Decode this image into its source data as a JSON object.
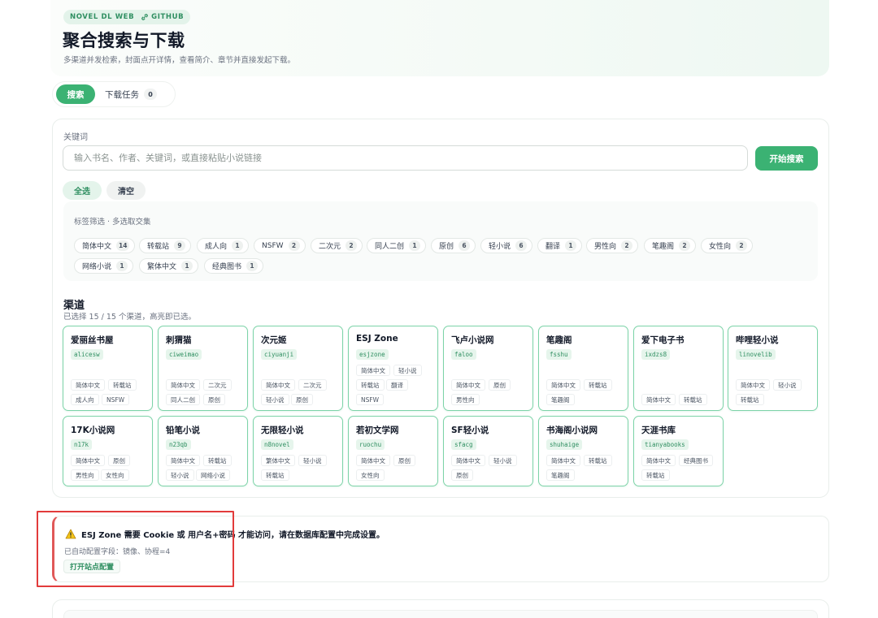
{
  "hero": {
    "tag": "NOVEL DL WEB",
    "github": "GITHUB",
    "title": "聚合搜索与下载",
    "subtitle": "多渠道并发检索，封面点开详情，查看简介、章节并直接发起下载。"
  },
  "tabs": {
    "search": "搜索",
    "downloads": "下载任务",
    "downloads_count": "0"
  },
  "search": {
    "label": "关键词",
    "placeholder": "输入书名、作者、关键词，或直接粘贴小说链接",
    "button": "开始搜索",
    "select_all": "全选",
    "clear": "清空"
  },
  "tags": {
    "title": "标签筛选 · 多选取交集",
    "items": [
      {
        "label": "简体中文",
        "count": "14"
      },
      {
        "label": "转载站",
        "count": "9"
      },
      {
        "label": "成人向",
        "count": "1"
      },
      {
        "label": "NSFW",
        "count": "2"
      },
      {
        "label": "二次元",
        "count": "2"
      },
      {
        "label": "同人二创",
        "count": "1"
      },
      {
        "label": "原创",
        "count": "6"
      },
      {
        "label": "轻小说",
        "count": "6"
      },
      {
        "label": "翻译",
        "count": "1"
      },
      {
        "label": "男性向",
        "count": "2"
      },
      {
        "label": "笔趣阁",
        "count": "2"
      },
      {
        "label": "女性向",
        "count": "2"
      },
      {
        "label": "网络小说",
        "count": "1"
      },
      {
        "label": "繁体中文",
        "count": "1"
      },
      {
        "label": "经典图书",
        "count": "1"
      }
    ]
  },
  "channels": {
    "title": "渠道",
    "subtitle": "已选择 15 / 15 个渠道，高亮即已选。",
    "items": [
      {
        "name": "爱丽丝书屋",
        "code": "alicesw",
        "tags": [
          "简体中文",
          "转载站",
          "成人向",
          "NSFW"
        ]
      },
      {
        "name": "刺猬猫",
        "code": "ciweimao",
        "tags": [
          "简体中文",
          "二次元",
          "同人二创",
          "原创"
        ]
      },
      {
        "name": "次元姬",
        "code": "ciyuanji",
        "tags": [
          "简体中文",
          "二次元",
          "轻小说",
          "原创"
        ]
      },
      {
        "name": "ESJ Zone",
        "code": "esjzone",
        "tags": [
          "简体中文",
          "轻小说",
          "转载站",
          "翻译",
          "NSFW"
        ]
      },
      {
        "name": "飞卢小说网",
        "code": "faloo",
        "tags": [
          "简体中文",
          "原创",
          "男性向"
        ]
      },
      {
        "name": "笔趣阁",
        "code": "fsshu",
        "tags": [
          "简体中文",
          "转载站",
          "笔趣阁"
        ]
      },
      {
        "name": "爱下电子书",
        "code": "ixdzs8",
        "tags": [
          "简体中文",
          "转载站"
        ]
      },
      {
        "name": "哔哩轻小说",
        "code": "linovelib",
        "tags": [
          "简体中文",
          "轻小说",
          "转载站"
        ]
      },
      {
        "name": "17K小说网",
        "code": "n17k",
        "tags": [
          "简体中文",
          "原创",
          "男性向",
          "女性向"
        ]
      },
      {
        "name": "铅笔小说",
        "code": "n23qb",
        "tags": [
          "简体中文",
          "转载站",
          "轻小说",
          "网络小说"
        ]
      },
      {
        "name": "无限轻小说",
        "code": "n8novel",
        "tags": [
          "繁体中文",
          "轻小说",
          "转载站"
        ]
      },
      {
        "name": "若初文学网",
        "code": "ruochu",
        "tags": [
          "简体中文",
          "原创",
          "女性向"
        ]
      },
      {
        "name": "SF轻小说",
        "code": "sfacg",
        "tags": [
          "简体中文",
          "轻小说",
          "原创"
        ]
      },
      {
        "name": "书海阁小说网",
        "code": "shuhaige",
        "tags": [
          "简体中文",
          "转载站",
          "笔趣阁"
        ]
      },
      {
        "name": "天涯书库",
        "code": "tianyabooks",
        "tags": [
          "简体中文",
          "经典图书",
          "转载站"
        ]
      }
    ]
  },
  "alert": {
    "title": "ESJ Zone 需要 Cookie 或 用户名+密码 才能访问，请在数据库配置中完成设置。",
    "subtitle": "已自动配置字段：镜像、协程=4",
    "button": "打开站点配置"
  },
  "colors": {
    "accent": "#3bb273",
    "card_border": "#7dd3a8",
    "highlight": "#e23b3b"
  }
}
